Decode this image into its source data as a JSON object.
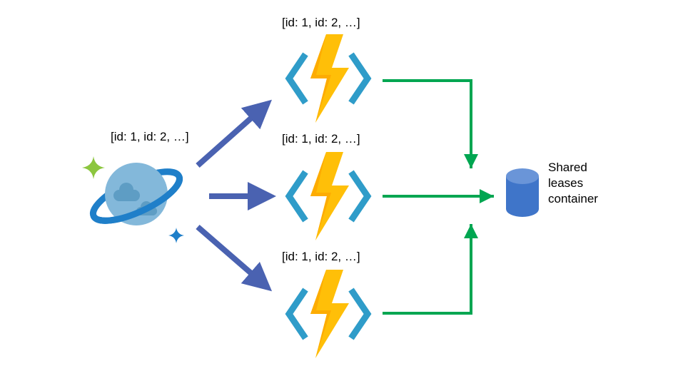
{
  "source": {
    "label": "[id: 1, id: 2, …]"
  },
  "functions": [
    {
      "label": "[id: 1, id: 2, …]"
    },
    {
      "label": "[id: 1, id: 2, …]"
    },
    {
      "label": "[id: 1, id: 2, …]"
    }
  ],
  "target": {
    "label": "Shared\nleases\ncontainer"
  },
  "colors": {
    "arrow_blue": "#4a62b1",
    "arrow_green": "#00a651",
    "database": "#3f75c9",
    "bracket": "#2f9cc9",
    "lightning": "#ffbf08",
    "lightning_shadow": "#fdac02"
  }
}
